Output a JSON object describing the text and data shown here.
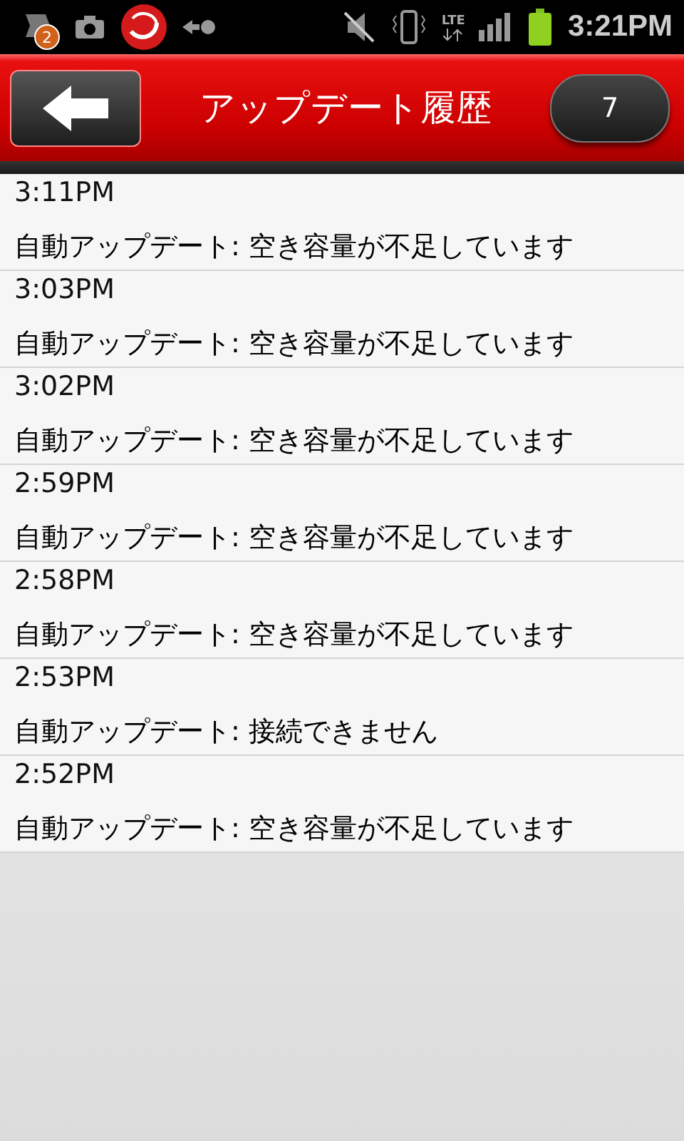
{
  "status_bar": {
    "notification_count": "2",
    "network": "LTE",
    "time": "3:21PM"
  },
  "header": {
    "title": "アップデート履歴",
    "count": "7"
  },
  "entries": [
    {
      "time": "3:11PM",
      "message": "自動アップデート: 空き容量が不足しています"
    },
    {
      "time": "3:03PM",
      "message": "自動アップデート: 空き容量が不足しています"
    },
    {
      "time": "3:02PM",
      "message": "自動アップデート: 空き容量が不足しています"
    },
    {
      "time": "2:59PM",
      "message": "自動アップデート: 空き容量が不足しています"
    },
    {
      "time": "2:58PM",
      "message": "自動アップデート: 空き容量が不足しています"
    },
    {
      "time": "2:53PM",
      "message": "自動アップデート: 接続できません"
    },
    {
      "time": "2:52PM",
      "message": "自動アップデート: 空き容量が不足しています"
    }
  ]
}
